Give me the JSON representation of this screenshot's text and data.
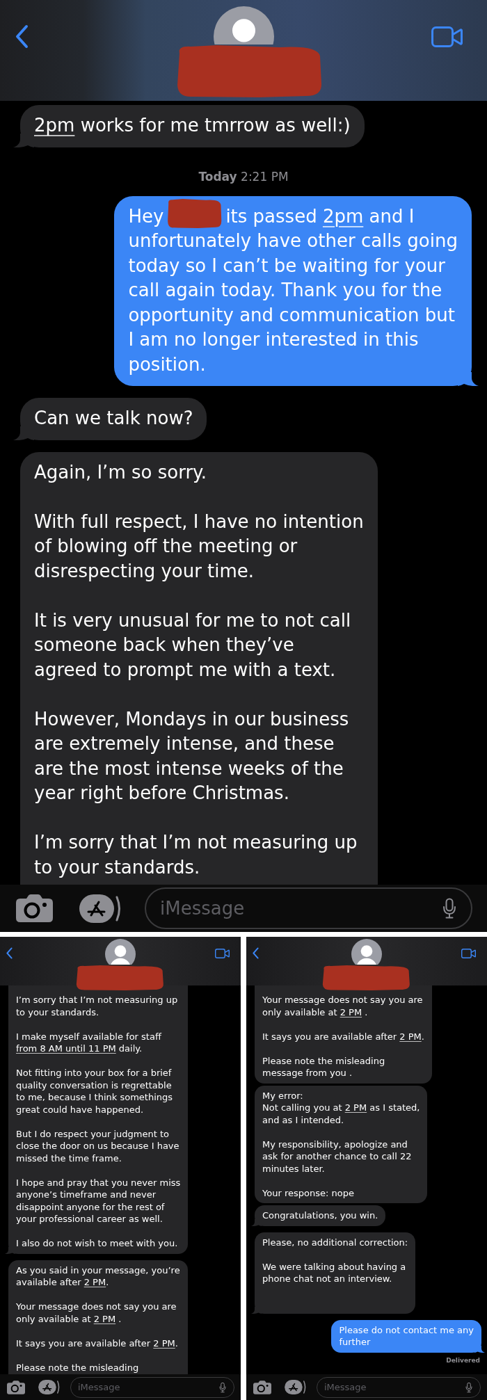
{
  "screenshots": [
    {
      "messages": [
        {
          "kind": "received",
          "tail": true,
          "cut_top": false,
          "cut_bottom": false,
          "blocks": [
            {
              "kind": "text",
              "runs": [
                {
                  "kind": "link",
                  "text": "2pm"
                },
                {
                  "kind": "text",
                  "text": " works for me tmrrow as well:)"
                }
              ]
            }
          ]
        },
        {
          "kind": "timestamp",
          "text": "**Today** 2:21 PM"
        },
        {
          "kind": "sent",
          "tail": true,
          "cut_top": false,
          "cut_bottom": false,
          "blocks": [
            {
              "kind": "text",
              "runs": [
                {
                  "kind": "text",
                  "text": "Hey"
                }
              ]
            },
            {
              "kind": "redaction"
            },
            {
              "kind": "text",
              "runs": [
                {
                  "kind": "text",
                  "text": "its passed "
                },
                {
                  "kind": "link",
                  "text": "2pm"
                },
                {
                  "kind": "text",
                  "text": " and I"
                }
              ]
            },
            {
              "kind": "text",
              "runs": [
                {
                  "kind": "text",
                  "text": "unfortunately have other calls going\ntoday so I can’t be waiting for your\ncall again today. Thank you for the\nopportunity and communication but\nI am no longer interested in this\nposition."
                }
              ]
            }
          ]
        },
        {
          "kind": "received",
          "tail": true,
          "cut_top": false,
          "cut_bottom": false,
          "blocks": [
            {
              "kind": "text",
              "runs": [
                {
                  "kind": "text",
                  "text": "Can we talk now?"
                }
              ]
            }
          ]
        },
        {
          "kind": "received",
          "tail": false,
          "cut_top": false,
          "cut_bottom": true,
          "blocks": [
            {
              "kind": "text",
              "runs": [
                {
                  "kind": "text",
                  "text": "Again, I’m so sorry.\n\nWith full respect, I have no intention\nof blowing off the meeting or\ndisrespecting your time.\n\nIt is very unusual for me to not call\nsomeone back when they’ve\nagreed to prompt me with a text.\n\nHowever, Mondays in our business\nare extremely intense, and these\nare the most intense weeks of the\nyear right before Christmas.\n\nI’m sorry that I’m not measuring up\nto your standards."
                }
              ]
            }
          ]
        }
      ],
      "composer": {
        "placeholder": "iMessage"
      }
    },
    {
      "messages": [
        {
          "kind": "received",
          "tail": true,
          "cut_top": true,
          "cut_bottom": false,
          "blocks": [
            {
              "kind": "text",
              "runs": [
                {
                  "kind": "text",
                  "text": "I’m sorry that I’m not measuring up\nto your standards.\n\nI make myself available for staff\n"
                },
                {
                  "kind": "link",
                  "text": "from 8 AM until 11 PM"
                },
                {
                  "kind": "text",
                  "text": " daily.\n\nNot fitting into your box for a brief\nquality conversation is regrettable\nto me, because I think somethings\ngreat could have happened.\n\nBut I do respect your judgment to\nclose the door on us because I have\nmissed the time frame.\n\nI hope and pray that you never miss\nanyone’s timeframe and never\ndisappoint anyone for the rest of\nyour professional career as well.\n\nI also do not wish to meet with you."
                }
              ]
            }
          ]
        },
        {
          "kind": "received",
          "tail": false,
          "cut_top": false,
          "cut_bottom": true,
          "blocks": [
            {
              "kind": "text",
              "runs": [
                {
                  "kind": "text",
                  "text": "As you said in your message, you’re\navailable after "
                },
                {
                  "kind": "link",
                  "text": "2 PM"
                },
                {
                  "kind": "text",
                  "text": ".\n\nYour message does not say you are\nonly available at "
                },
                {
                  "kind": "link",
                  "text": "2 PM"
                },
                {
                  "kind": "text",
                  "text": " .\n\nIt says you are available after "
                },
                {
                  "kind": "link",
                  "text": "2 PM"
                },
                {
                  "kind": "text",
                  "text": ".\n\nPlease note the misleading"
                }
              ]
            }
          ]
        }
      ],
      "composer": {
        "placeholder": "iMessage"
      }
    },
    {
      "messages": [
        {
          "kind": "received",
          "tail": false,
          "cut_top": true,
          "cut_bottom": false,
          "blocks": [
            {
              "kind": "text",
              "runs": [
                {
                  "kind": "text",
                  "text": "Your message does not say you are\nonly available at "
                },
                {
                  "kind": "link",
                  "text": "2 PM"
                },
                {
                  "kind": "text",
                  "text": " .\n\nIt says you are available after "
                },
                {
                  "kind": "link",
                  "text": "2 PM"
                },
                {
                  "kind": "text",
                  "text": ".\n\nPlease note the misleading\nmessage from you ."
                }
              ]
            }
          ]
        },
        {
          "kind": "received",
          "tail": false,
          "cut_top": false,
          "cut_bottom": false,
          "blocks": [
            {
              "kind": "text",
              "runs": [
                {
                  "kind": "text",
                  "text": "My error:\nNot calling you at "
                },
                {
                  "kind": "link",
                  "text": "2 PM"
                },
                {
                  "kind": "text",
                  "text": " as I stated,\nand as I intended.\n\nMy responsibility, apologize and\nask for another chance to call 22\nminutes later.\n\nYour response: nope"
                }
              ]
            }
          ]
        },
        {
          "kind": "received",
          "tail": true,
          "cut_top": false,
          "cut_bottom": false,
          "blocks": [
            {
              "kind": "text",
              "runs": [
                {
                  "kind": "text",
                  "text": "Congratulations, you win."
                }
              ]
            }
          ]
        },
        {
          "kind": "received",
          "tail": true,
          "cut_top": false,
          "cut_bottom": false,
          "blocks": [
            {
              "kind": "text",
              "runs": [
                {
                  "kind": "text",
                  "text": "Please, no additional correction:\n\nWe were talking about having a\nphone chat not an interview.\n\n\n"
                }
              ]
            }
          ]
        },
        {
          "kind": "sent",
          "tail": true,
          "cut_top": false,
          "cut_bottom": false,
          "blocks": [
            {
              "kind": "text",
              "runs": [
                {
                  "kind": "text",
                  "text": "Please do not contact me any\nfurther"
                }
              ]
            }
          ]
        },
        {
          "kind": "status",
          "text": "Delivered"
        }
      ],
      "composer": {
        "placeholder": "iMessage"
      }
    }
  ]
}
